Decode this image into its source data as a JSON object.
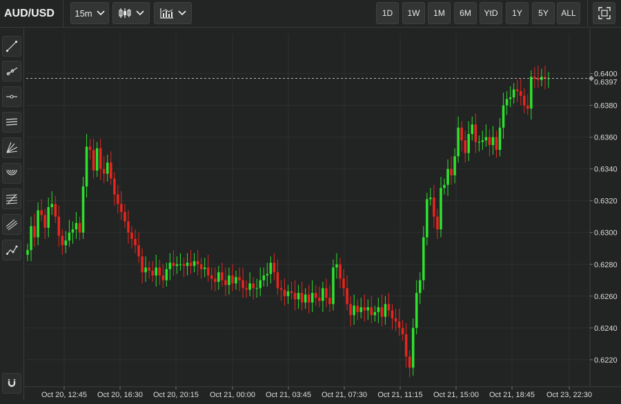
{
  "header": {
    "symbol": "AUD/USD",
    "interval": "15m",
    "chart_type_icon": "candlestick-icon",
    "indicators_icon": "indicators-icon",
    "fullscreen_icon": "fullscreen-icon",
    "ranges": [
      "1D",
      "1W",
      "1M",
      "6M",
      "YtD",
      "1Y",
      "5Y",
      "ALL"
    ]
  },
  "sidebar": {
    "tools": [
      "trend-line-icon",
      "ray-icon",
      "horizontal-line-icon",
      "parallel-channel-icon",
      "fan-icon",
      "arc-icon",
      "fib-retracement-icon",
      "pitchfork-icon",
      "path-icon"
    ],
    "bottom_tool": "magnet-icon"
  },
  "colors": {
    "up": "#2ee22e",
    "down": "#e8251e",
    "background": "#222423",
    "grid": "#2e3030",
    "text": "#dcdcdc"
  },
  "chart_data": {
    "type": "candlestick",
    "title": "",
    "ylim": [
      0.6203,
      0.6425
    ],
    "yticks": [
      0.622,
      0.624,
      0.626,
      0.628,
      0.63,
      0.632,
      0.634,
      0.636,
      0.638,
      0.64
    ],
    "ytick_labels": [
      "0.6220",
      "0.6240",
      "0.6260",
      "0.6280",
      "0.6300",
      "0.6320",
      "0.6340",
      "0.6360",
      "0.6380",
      "0.6400"
    ],
    "xtick_labels": [
      "Oct 20, 12:45",
      "Oct 20, 16:30",
      "Oct 20, 20:15",
      "Oct 21, 00:00",
      "Oct 21, 03:45",
      "Oct 21, 07:30",
      "Oct 21, 11:15",
      "Oct 21, 15:00",
      "Oct 21, 18:45",
      "Oct 23, 22:30"
    ],
    "current_price": 0.6397,
    "current_price_label": "0.6397",
    "grid": true,
    "bars_estimated": [
      0.6289,
      0.6304,
      0.6297,
      0.6314,
      0.6311,
      0.6303,
      0.6316,
      0.6318,
      0.631,
      0.6298,
      0.6292,
      0.6295,
      0.63,
      0.6302,
      0.6306,
      0.63,
      0.6329,
      0.6354,
      0.6352,
      0.6339,
      0.6353,
      0.634,
      0.6337,
      0.6344,
      0.6334,
      0.6324,
      0.6318,
      0.6313,
      0.6307,
      0.63,
      0.6296,
      0.6292,
      0.6285,
      0.6275,
      0.6278,
      0.6276,
      0.6273,
      0.6278,
      0.6273,
      0.627,
      0.6277,
      0.6281,
      0.6279,
      0.628,
      0.628,
      0.6279,
      0.6281,
      0.6279,
      0.6282,
      0.628,
      0.6277,
      0.6278,
      0.6273,
      0.6271,
      0.6269,
      0.6275,
      0.627,
      0.6267,
      0.6273,
      0.6268,
      0.6272,
      0.627,
      0.6265,
      0.6264,
      0.6268,
      0.6265,
      0.6265,
      0.627,
      0.6273,
      0.6274,
      0.6281,
      0.6275,
      0.6265,
      0.6264,
      0.626,
      0.6263,
      0.6262,
      0.6258,
      0.6262,
      0.6256,
      0.6261,
      0.6256,
      0.6262,
      0.6259,
      0.6257,
      0.6265,
      0.6259,
      0.6255,
      0.6278,
      0.628,
      0.6271,
      0.6265,
      0.6255,
      0.6248,
      0.6254,
      0.625,
      0.6253,
      0.6251,
      0.6253,
      0.6248,
      0.625,
      0.6253,
      0.6247,
      0.6255,
      0.6251,
      0.6246,
      0.6244,
      0.624,
      0.6236,
      0.6222,
      0.6215,
      0.624,
      0.6262,
      0.627,
      0.6297,
      0.6321,
      0.6322,
      0.631,
      0.6302,
      0.6328,
      0.633,
      0.634,
      0.6336,
      0.6348,
      0.6366,
      0.6358,
      0.635,
      0.6362,
      0.6368,
      0.6357,
      0.6357,
      0.6358,
      0.636,
      0.6355,
      0.636,
      0.6352,
      0.6366,
      0.638,
      0.6384,
      0.6385,
      0.639,
      0.6389,
      0.6386,
      0.638,
      0.6378,
      0.6398,
      0.6397,
      0.6396,
      0.6398,
      0.6397,
      0.6397
    ]
  }
}
